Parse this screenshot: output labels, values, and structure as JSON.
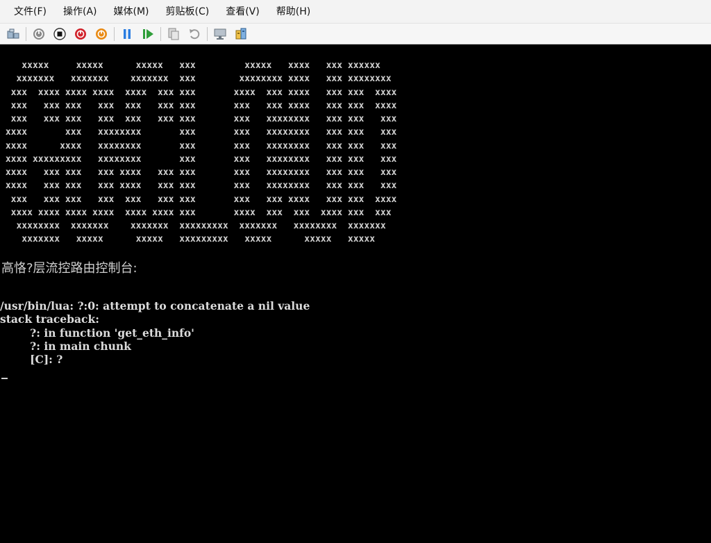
{
  "menu": [
    {
      "name": "menu-file",
      "label": "文件(F)"
    },
    {
      "name": "menu-action",
      "label": "操作(A)"
    },
    {
      "name": "menu-media",
      "label": "媒体(M)"
    },
    {
      "name": "menu-clipboard",
      "label": "剪贴板(C)"
    },
    {
      "name": "menu-view",
      "label": "查看(V)"
    },
    {
      "name": "menu-help",
      "label": "帮助(H)"
    }
  ],
  "toolbar_icons": [
    "ctrl-alt-del-icon",
    "start-icon",
    "turn-off-icon",
    "shutdown-icon",
    "save-state-icon",
    "pause-icon",
    "resume-icon",
    "checkpoint-icon",
    "revert-icon",
    "enhanced-session-icon",
    "share-icon"
  ],
  "colors": {
    "console_bg": "#000000",
    "console_text": "#dcdcdc",
    "menubar_bg": "#f3f3f3"
  },
  "console": {
    "banner": "    xxxxx     xxxxx      xxxxx   xxx         xxxxx   xxxx   xxx xxxxxx\n   xxxxxxx   xxxxxxx    xxxxxxx  xxx        xxxxxxxx xxxx   xxx xxxxxxxx\n  xxx  xxxx xxxx xxxx  xxxx  xxx xxx       xxxx  xxx xxxx   xxx xxx  xxxx\n  xxx   xxx xxx   xxx  xxx   xxx xxx       xxx   xxx xxxx   xxx xxx  xxxx\n  xxx   xxx xxx   xxx  xxx   xxx xxx       xxx   xxxxxxxx   xxx xxx   xxx\n xxxx       xxx   xxxxxxxx       xxx       xxx   xxxxxxxx   xxx xxx   xxx\n xxxx      xxxx   xxxxxxxx       xxx       xxx   xxxxxxxx   xxx xxx   xxx\n xxxx xxxxxxxxx   xxxxxxxx       xxx       xxx   xxxxxxxx   xxx xxx   xxx\n xxxx   xxx xxx   xxx xxxx   xxx xxx       xxx   xxxxxxxx   xxx xxx   xxx\n xxxx   xxx xxx   xxx xxxx   xxx xxx       xxx   xxxxxxxx   xxx xxx   xxx\n  xxx   xxx xxx   xxx  xxx   xxx xxx       xxx   xxx xxxx   xxx xxx  xxxx\n  xxxx xxxx xxxx xxxx  xxxx xxxx xxx       xxxx  xxx  xxx  xxxx xxx  xxx\n   xxxxxxxx  xxxxxxx    xxxxxxx  xxxxxxxxx  xxxxxxx   xxxxxxxx  xxxxxxx\n    xxxxxxx   xxxxx      xxxxx   xxxxxxxxx   xxxxx      xxxxx   xxxxx",
    "console_title": "高恪?层流控路由控制台:",
    "error_lines": "/usr/bin/lua: ?:0: attempt to concatenate a nil value\nstack traceback:\n        ?: in function 'get_eth_info'\n        ?: in main chunk\n        [C]: ?"
  }
}
